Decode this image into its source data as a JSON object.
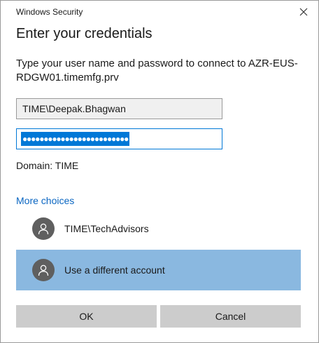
{
  "window": {
    "title": "Windows Security"
  },
  "dialog": {
    "heading": "Enter your credentials",
    "message": "Type your user name and password to connect to AZR-EUS-RDGW01.timemfg.prv",
    "username_value": "TIME\\Deepak.Bhagwan",
    "password_mask": "●●●●●●●●●●●●●●●●●●●●●●●●●",
    "domain": "Domain: TIME",
    "more_choices": "More choices",
    "accounts": [
      {
        "label": "TIME\\TechAdvisors",
        "icon": "user-avatar-icon",
        "selected": false
      },
      {
        "label": "Use a different account",
        "icon": "user-avatar-icon",
        "selected": true
      }
    ],
    "ok_label": "OK",
    "cancel_label": "Cancel"
  },
  "colors": {
    "accent": "#0078d7",
    "link": "#0a66c2",
    "selected_row": "#8ab8e0",
    "button_bg": "#cccccc",
    "avatar_bg": "#5f5f5f"
  }
}
